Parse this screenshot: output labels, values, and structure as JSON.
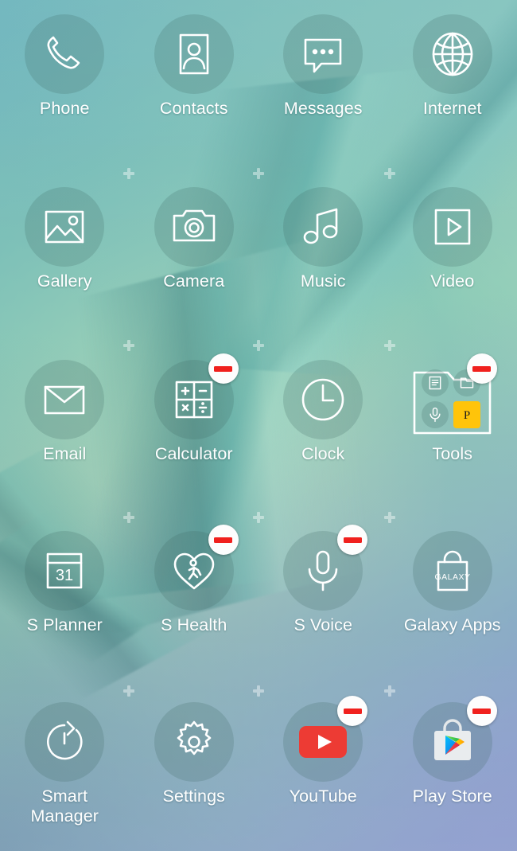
{
  "screen": {
    "name": "home-screen",
    "mode": "edit-remove-mode",
    "columns": 4,
    "rows": 5,
    "colors": {
      "wallpaper_top_left": "#74b8bb",
      "wallpaper_center": "#aedcb9",
      "wallpaper_bottom_right": "#8d9ccd",
      "label_text": "#ffffff",
      "badge_background": "#fdfdfd",
      "badge_bar": "#f0201d",
      "icon_disc": "rgba(64,106,100,0.22)",
      "youtube_red": "#ed3b34",
      "playstore_bag": "#e8ebec",
      "tools_yellow": "#ffc40a"
    }
  },
  "badge": {
    "name": "remove-badge",
    "glyph": "minus"
  },
  "apps": [
    {
      "label": "Phone",
      "icon": "phone-icon",
      "removable": false,
      "row": 0,
      "col": 0
    },
    {
      "label": "Contacts",
      "icon": "contacts-icon",
      "removable": false,
      "row": 0,
      "col": 1
    },
    {
      "label": "Messages",
      "icon": "messages-icon",
      "removable": false,
      "row": 0,
      "col": 2
    },
    {
      "label": "Internet",
      "icon": "internet-icon",
      "removable": false,
      "row": 0,
      "col": 3
    },
    {
      "label": "Gallery",
      "icon": "gallery-icon",
      "removable": false,
      "row": 1,
      "col": 0
    },
    {
      "label": "Camera",
      "icon": "camera-icon",
      "removable": false,
      "row": 1,
      "col": 1
    },
    {
      "label": "Music",
      "icon": "music-icon",
      "removable": false,
      "row": 1,
      "col": 2
    },
    {
      "label": "Video",
      "icon": "video-icon",
      "removable": false,
      "row": 1,
      "col": 3
    },
    {
      "label": "Email",
      "icon": "email-icon",
      "removable": false,
      "row": 2,
      "col": 0
    },
    {
      "label": "Calculator",
      "icon": "calculator-icon",
      "removable": true,
      "row": 2,
      "col": 1
    },
    {
      "label": "Clock",
      "icon": "clock-icon",
      "removable": false,
      "row": 2,
      "col": 2
    },
    {
      "label": "Tools",
      "icon": "tools-folder-icon",
      "removable": true,
      "row": 2,
      "col": 3
    },
    {
      "label": "S Planner",
      "icon": "s-planner-icon",
      "removable": false,
      "row": 3,
      "col": 0
    },
    {
      "label": "S Health",
      "icon": "s-health-icon",
      "removable": true,
      "row": 3,
      "col": 1
    },
    {
      "label": "S Voice",
      "icon": "s-voice-icon",
      "removable": true,
      "row": 3,
      "col": 2
    },
    {
      "label": "Galaxy Apps",
      "icon": "galaxy-apps-icon",
      "removable": false,
      "row": 3,
      "col": 3
    },
    {
      "label": "Smart\nManager",
      "icon": "smart-manager-icon",
      "removable": false,
      "row": 4,
      "col": 0
    },
    {
      "label": "Settings",
      "icon": "settings-icon",
      "removable": false,
      "row": 4,
      "col": 1
    },
    {
      "label": "YouTube",
      "icon": "youtube-icon",
      "removable": true,
      "row": 4,
      "col": 2
    },
    {
      "label": "Play Store",
      "icon": "play-store-icon",
      "removable": true,
      "row": 4,
      "col": 3
    }
  ],
  "icon_text": {
    "s_planner_day": "31",
    "galaxy_apps_word": "GALAXY",
    "tools_badge_letter": "P"
  },
  "tools_folder": {
    "name": "tools-folder",
    "contents": [
      "memo-icon",
      "my-files-icon",
      "voice-recorder-icon",
      "pen-up-icon"
    ]
  }
}
